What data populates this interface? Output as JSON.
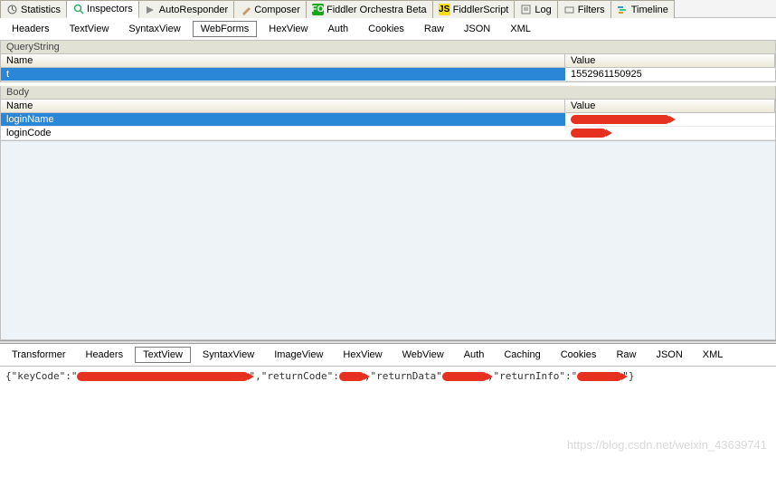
{
  "mainTabs": {
    "statistics": "Statistics",
    "inspectors": "Inspectors",
    "autoResponder": "AutoResponder",
    "composer": "Composer",
    "orchestra": "Fiddler Orchestra Beta",
    "fiddlerScript": "FiddlerScript",
    "log": "Log",
    "filters": "Filters",
    "timeline": "Timeline"
  },
  "reqTabs": {
    "headers": "Headers",
    "textview": "TextView",
    "syntaxview": "SyntaxView",
    "webforms": "WebForms",
    "hexview": "HexView",
    "auth": "Auth",
    "cookies": "Cookies",
    "raw": "Raw",
    "json": "JSON",
    "xml": "XML"
  },
  "sections": {
    "queryString": "QueryString",
    "body": "Body"
  },
  "gridHeaders": {
    "name": "Name",
    "value": "Value"
  },
  "queryRows": [
    {
      "name": "t",
      "value": "1552961150925"
    }
  ],
  "bodyRows": [
    {
      "name": "loginName",
      "value": ""
    },
    {
      "name": "loginCode",
      "value": ""
    }
  ],
  "respTabs": {
    "transformer": "Transformer",
    "headers": "Headers",
    "textview": "TextView",
    "syntaxview": "SyntaxView",
    "imageview": "ImageView",
    "hexview": "HexView",
    "webview": "WebView",
    "auth": "Auth",
    "caching": "Caching",
    "cookies": "Cookies",
    "raw": "Raw",
    "json": "JSON",
    "xml": "XML"
  },
  "responseText": {
    "open": "{\"keyCode\":\"",
    "k_returnCode": "\",\"returnCode\":",
    "k_returnData": ",\"returnData\"",
    "k_returnInfo": ",\"returnInfo\":\"",
    "close": "\"}"
  },
  "watermark": "https://blog.csdn.net/weixin_43639741"
}
